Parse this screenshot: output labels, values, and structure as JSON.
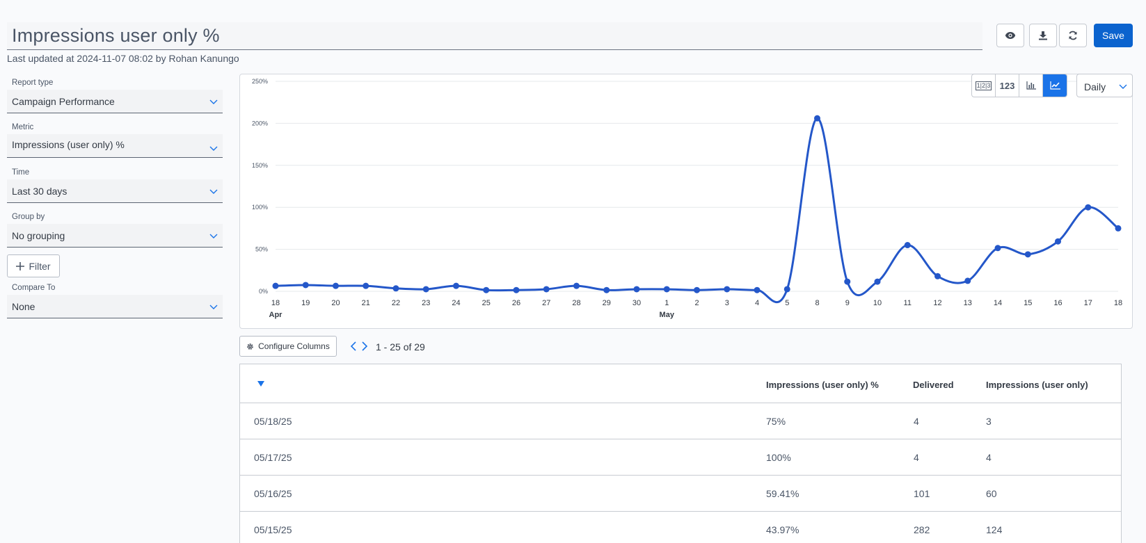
{
  "header": {
    "title": "Impressions user only %",
    "last_updated": "Last updated at 2024-11-07 08:02 by Rohan Kanungo",
    "save_label": "Save"
  },
  "sidebar": {
    "report_type": {
      "label": "Report type",
      "value": "Campaign Performance"
    },
    "metric": {
      "label": "Metric",
      "value": "Impressions (user only) %"
    },
    "time": {
      "label": "Time",
      "value": "Last 30 days"
    },
    "group_by": {
      "label": "Group by",
      "value": "No grouping"
    },
    "filter_label": "Filter",
    "compare_to": {
      "label": "Compare To",
      "value": "None"
    }
  },
  "chart_controls": {
    "table_icon_label": "1|2|3",
    "number_label": "123",
    "granularity": "Daily"
  },
  "chart_data": {
    "type": "line",
    "x": [
      "18",
      "19",
      "20",
      "21",
      "22",
      "23",
      "24",
      "25",
      "26",
      "27",
      "28",
      "29",
      "30",
      "1",
      "2",
      "3",
      "4",
      "5",
      "8",
      "9",
      "10",
      "11",
      "12",
      "13",
      "14",
      "15",
      "16",
      "17",
      "18"
    ],
    "month_labels": [
      {
        "at": 0,
        "text": "Apr"
      },
      {
        "at": 13,
        "text": "May"
      }
    ],
    "series": [
      {
        "values": [
          6.5,
          7.5,
          6.5,
          6.5,
          3.5,
          2.5,
          6.5,
          1.5,
          1.5,
          2.5,
          6.5,
          1.5,
          2.5,
          2.5,
          1.5,
          2.5,
          1.5,
          2.5,
          206,
          11.5,
          11.5,
          55,
          18,
          12.5,
          51.5,
          44,
          59.41,
          100,
          75
        ]
      }
    ],
    "y_ticks": [
      "0%",
      "50%",
      "100%",
      "150%",
      "200%",
      "250%"
    ],
    "ylim": [
      0,
      250
    ],
    "grid": true,
    "color": "#2457c9"
  },
  "table": {
    "configure_label": "Configure Columns",
    "range": "1 - 25 of 29",
    "columns": [
      "Impressions (user only) %",
      "Delivered",
      "Impressions (user only)"
    ],
    "rows": [
      {
        "date": "05/18/25",
        "pct": "75%",
        "delivered": "4",
        "impressions": "3"
      },
      {
        "date": "05/17/25",
        "pct": "100%",
        "delivered": "4",
        "impressions": "4"
      },
      {
        "date": "05/16/25",
        "pct": "59.41%",
        "delivered": "101",
        "impressions": "60"
      },
      {
        "date": "05/15/25",
        "pct": "43.97%",
        "delivered": "282",
        "impressions": "124"
      }
    ]
  }
}
